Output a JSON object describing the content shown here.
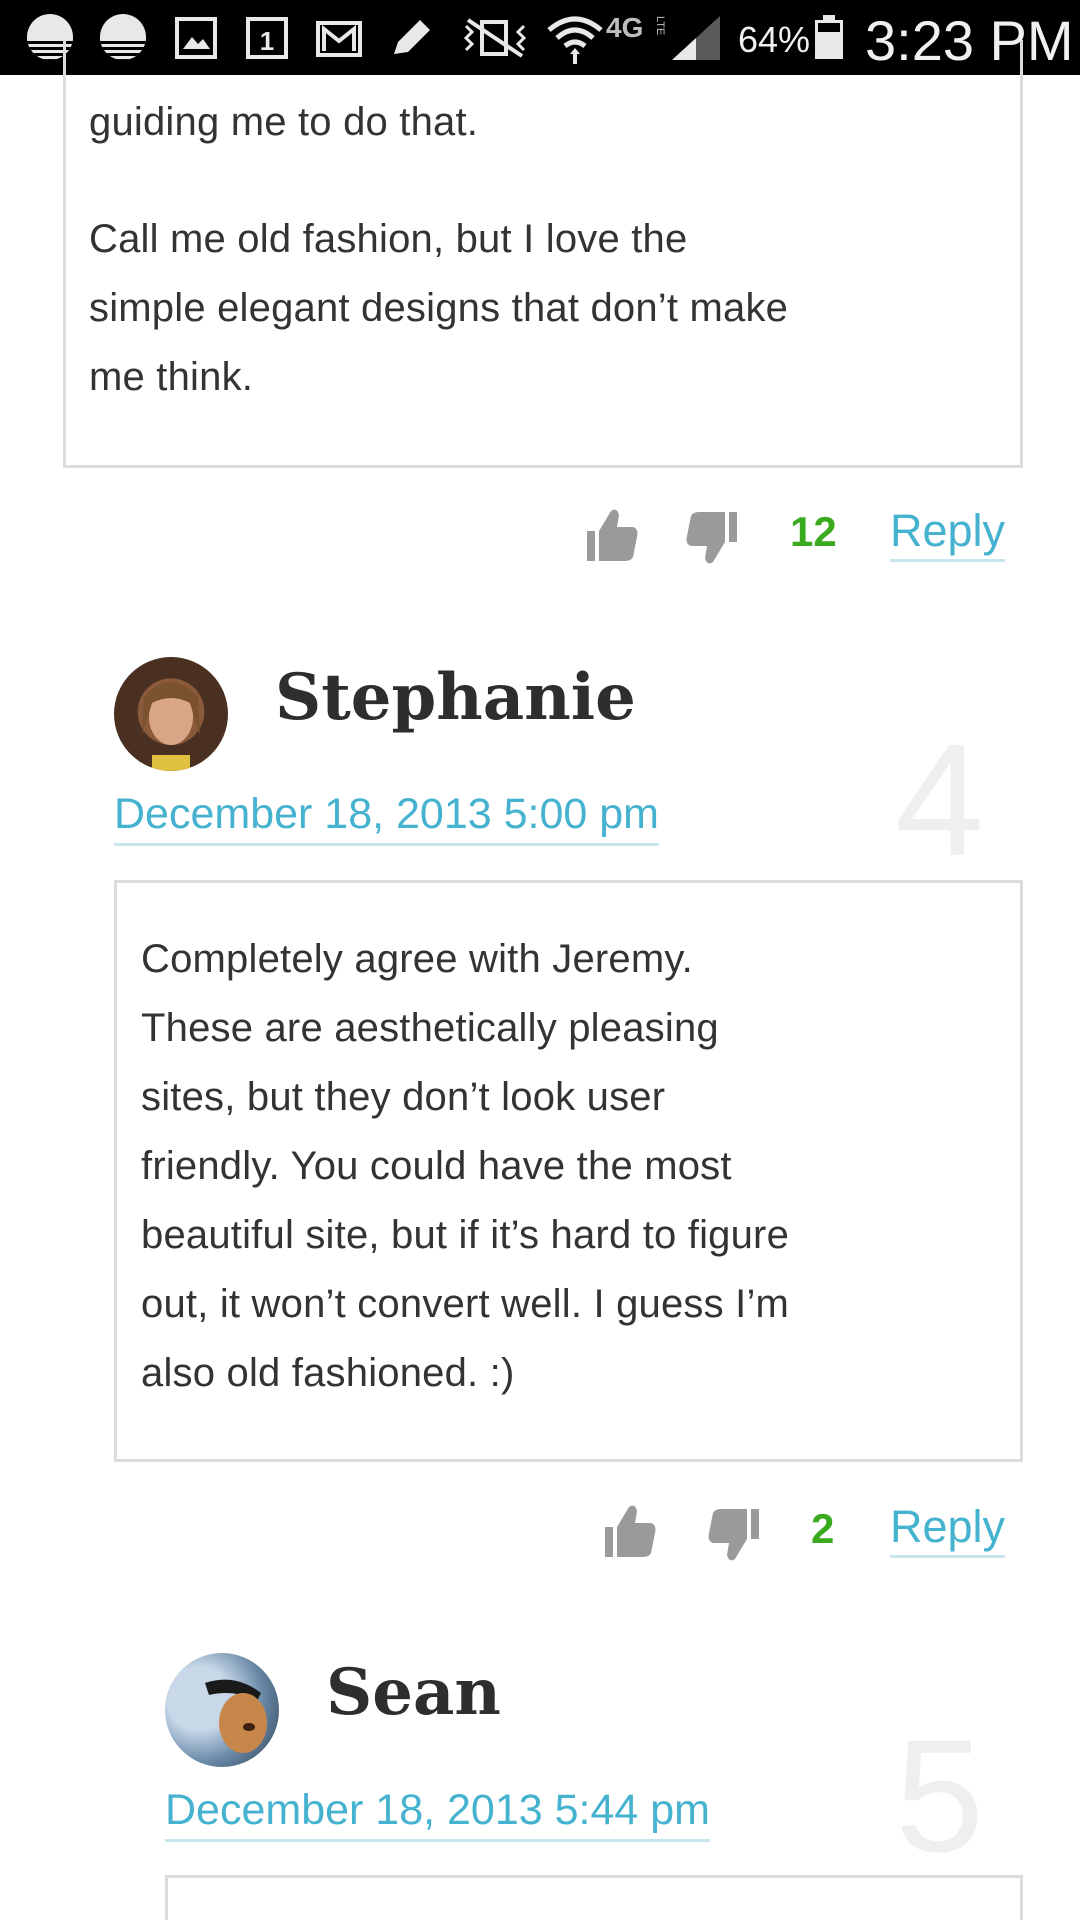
{
  "status_bar": {
    "network": "4G",
    "network_sub": "LTE",
    "battery": "64%",
    "time": "3:23 PM"
  },
  "comment_prev": {
    "lines": [
      "guiding me to do that.",
      "Call me old fashion, but I love the",
      "simple elegant designs that don’t make",
      "me think."
    ],
    "votes": "12",
    "reply": "Reply"
  },
  "comment_stephanie": {
    "author": "Stephanie",
    "date": "December 18, 2013 5:00 pm",
    "number": "4",
    "lines": [
      "Completely agree with Jeremy.",
      "These are aesthetically pleasing",
      "sites, but they don’t look user",
      "friendly. You could have the most",
      "beautiful site, but if it’s hard to figure",
      "out, it won’t convert well. I guess I’m",
      "also old fashioned. :)"
    ],
    "votes": "2",
    "reply": "Reply"
  },
  "comment_sean": {
    "author": "Sean",
    "date": "December 18, 2013 5:44 pm",
    "number": "5"
  },
  "colors": {
    "link": "#45b2cf",
    "votes": "#3aaa1e",
    "border": "#dcdcdc"
  }
}
